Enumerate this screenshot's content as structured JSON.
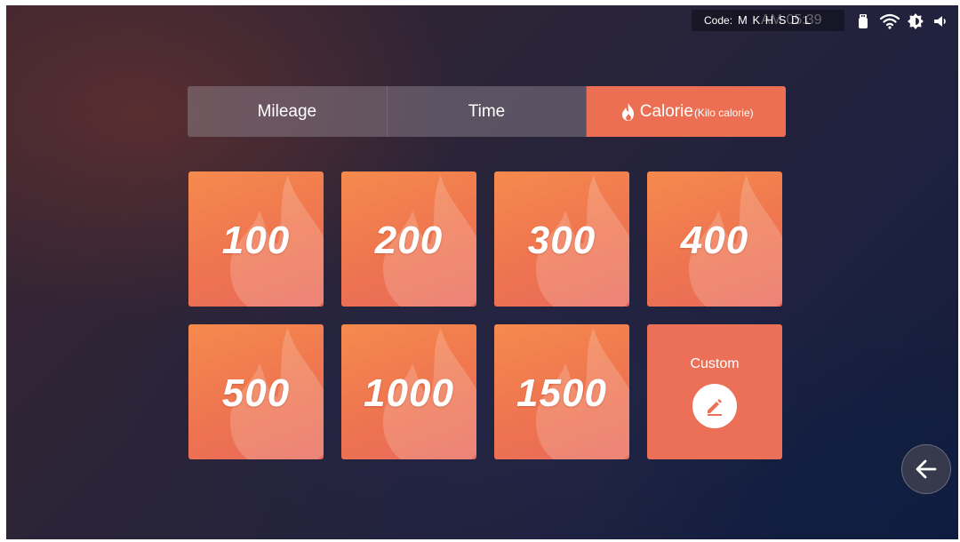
{
  "status_bar": {
    "code_label": "Code:",
    "code_value": "M K H S D L",
    "clock": "AM 05:39",
    "icons": [
      "usb-icon",
      "wifi-icon",
      "brightness-icon",
      "volume-icon"
    ]
  },
  "tabs": [
    {
      "label": "Mileage",
      "active": false
    },
    {
      "label": "Time",
      "active": false
    },
    {
      "label": "Calorie",
      "sublabel": "(Kilo calorie)",
      "icon": "flame-icon",
      "active": true
    }
  ],
  "presets": [
    {
      "value": "100"
    },
    {
      "value": "200"
    },
    {
      "value": "300"
    },
    {
      "value": "400"
    },
    {
      "value": "500"
    },
    {
      "value": "1000"
    },
    {
      "value": "1500"
    }
  ],
  "custom": {
    "label": "Custom",
    "icon": "pencil-icon"
  },
  "back": {
    "icon": "arrow-left-icon"
  },
  "colors": {
    "accent": "#ec6f53",
    "tile_gradient_start": "#f58a4d",
    "tile_gradient_end": "#e8695a"
  }
}
